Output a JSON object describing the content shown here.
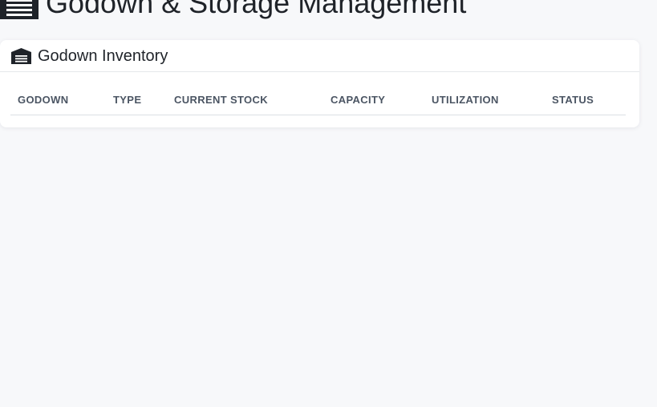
{
  "header": {
    "title": "Godown & Storage Management",
    "icon": "warehouse-icon"
  },
  "inventory_card": {
    "title": "Godown Inventory",
    "icon": "warehouse-icon",
    "columns": [
      "GODOWN",
      "TYPE",
      "CURRENT STOCK",
      "CAPACITY",
      "UTILIZATION",
      "STATUS"
    ],
    "rows": []
  },
  "colors": {
    "page_background": "#f7f8fa",
    "card_background": "#ffffff",
    "text_primary": "#1f2329",
    "text_header": "#4b5563",
    "border": "#e5e7eb"
  }
}
